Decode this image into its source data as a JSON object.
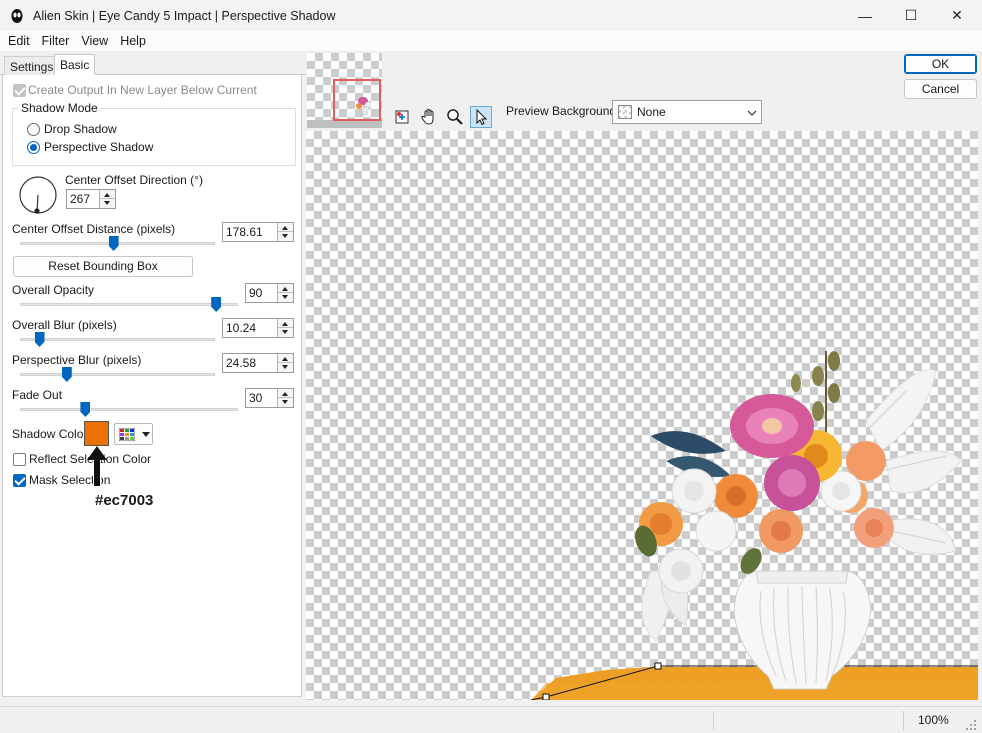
{
  "window": {
    "title": "Alien Skin | Eye Candy 5 Impact | Perspective Shadow",
    "minimize": "—",
    "maximize": "☐",
    "close": "✕"
  },
  "menu": [
    "Edit",
    "Filter",
    "View",
    "Help"
  ],
  "tabs": {
    "settings": "Settings",
    "basic": "Basic"
  },
  "basic": {
    "create_output_label": "Create Output In New Layer Below Current",
    "create_output_checked": true,
    "shadow_mode": {
      "title": "Shadow Mode",
      "options": [
        "Drop Shadow",
        "Perspective Shadow"
      ],
      "selected": "Perspective Shadow"
    },
    "center_offset_direction": {
      "label": "Center Offset Direction (°)",
      "value": "267"
    },
    "center_offset_distance": {
      "label": "Center Offset Distance (pixels)",
      "value": "178.61",
      "slider_fraction": 0.48
    },
    "reset_button": "Reset Bounding Box",
    "overall_opacity": {
      "label": "Overall Opacity",
      "value": "90",
      "slider_fraction": 0.9
    },
    "overall_blur": {
      "label": "Overall Blur (pixels)",
      "value": "10.24",
      "slider_fraction": 0.1
    },
    "perspective_blur": {
      "label": "Perspective Blur (pixels)",
      "value": "24.58",
      "slider_fraction": 0.24
    },
    "fade_out": {
      "label": "Fade Out",
      "value": "30",
      "slider_fraction": 0.3
    },
    "shadow_color": {
      "label": "Shadow Color",
      "color": "#ec7003"
    },
    "reflect_label": "Reflect Selection Color",
    "reflect_checked": false,
    "mask_label": "Mask Selection",
    "mask_checked": true,
    "annotation": "#ec7003"
  },
  "preview": {
    "background_label": "Preview Background:",
    "background_value": "None",
    "tools": [
      "navigate-preview-icon",
      "hand-icon",
      "zoom-icon",
      "pointer-icon"
    ]
  },
  "buttons": {
    "ok": "OK",
    "cancel": "Cancel"
  },
  "status": {
    "zoom": "100%"
  }
}
